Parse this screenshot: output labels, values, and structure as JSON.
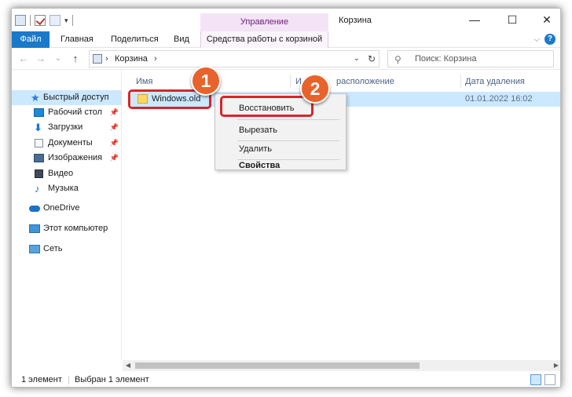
{
  "titlebar": {
    "manage_tab": "Управление",
    "window_title": "Корзина",
    "minimize": "—",
    "maximize": "☐",
    "close": "✕"
  },
  "ribbon": {
    "tabs": [
      "Файл",
      "Главная",
      "Поделиться",
      "Вид"
    ],
    "tools_tab": "Средства работы с корзиной",
    "expand": "⌵",
    "help": "?"
  },
  "nav": {
    "back": "←",
    "forward": "→",
    "recent": "⌄",
    "up": "↑",
    "crumb_sep": "›",
    "breadcrumb": "Корзина",
    "crumb_sep_end": "›",
    "address_dropdown": "⌄",
    "refresh": "↻",
    "search_icon": "⚲",
    "search_placeholder": "Поиск: Корзина"
  },
  "sidebar": {
    "quick_access": "Быстрый доступ",
    "items": [
      {
        "label": "Рабочий стол",
        "pin": "📌"
      },
      {
        "label": "Загрузки",
        "pin": "📌"
      },
      {
        "label": "Документы",
        "pin": "📌"
      },
      {
        "label": "Изображения",
        "pin": "📌"
      },
      {
        "label": "Видео"
      },
      {
        "label": "Музыка"
      }
    ],
    "onedrive": "OneDrive",
    "this_pc": "Этот компьютер",
    "network": "Сеть"
  },
  "columns": {
    "name": "Имя",
    "location_prefix": "И",
    "location_suffix": "расположение",
    "date": "Дата удаления"
  },
  "files": [
    {
      "name": "Windows.old",
      "deleted": "01.01.2022 16:02"
    }
  ],
  "context_menu": {
    "restore": "Восстановить",
    "cut": "Вырезать",
    "delete": "Удалить",
    "properties": "Свойства"
  },
  "annotations": {
    "step1": "1",
    "step2": "2",
    "accent": "#e8632b",
    "outline": "#d9242c"
  },
  "status": {
    "count": "1 элемент",
    "selected": "Выбран 1 элемент"
  },
  "scrollbar": {
    "left": "◀",
    "right": "▶"
  },
  "colors": {
    "file_tab": "#1979ca",
    "manage_tab_bg": "#f4e3f7",
    "selection": "#cce8ff"
  }
}
